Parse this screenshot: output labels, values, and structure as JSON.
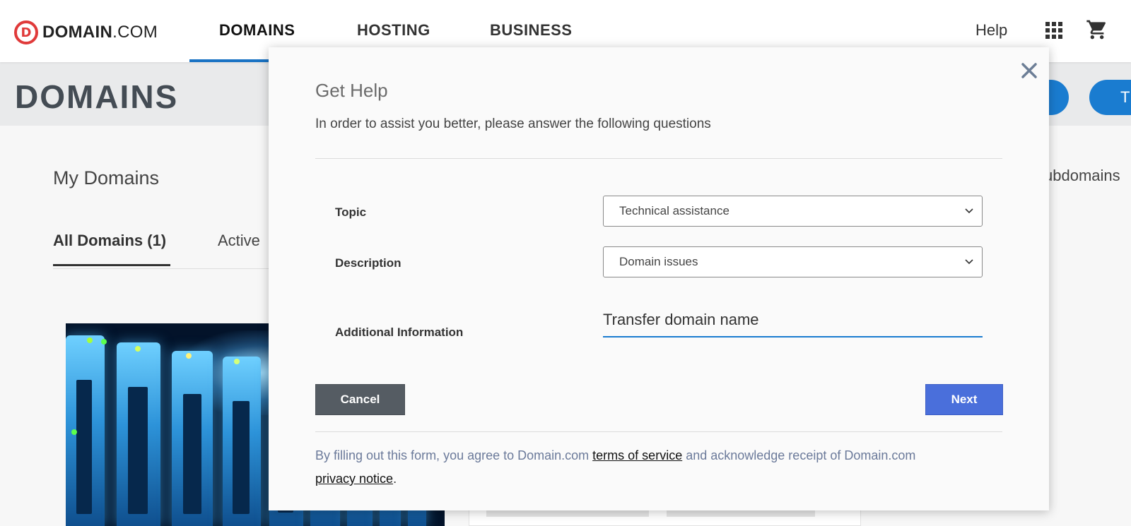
{
  "brand": {
    "logo_mark": "D",
    "name_bold": "DOMAIN",
    "name_light": ".COM"
  },
  "nav": {
    "items": [
      {
        "label": "DOMAINS",
        "active": true
      },
      {
        "label": "HOSTING",
        "active": false
      },
      {
        "label": "BUSINESS",
        "active": false
      }
    ],
    "help": "Help",
    "apps_icon": "apps-grid-icon",
    "cart_icon": "shopping-cart-icon"
  },
  "page": {
    "title": "DOMAINS",
    "button_partial": "T"
  },
  "background": {
    "section_title": "My Domains",
    "tabs": [
      "All Domains (1)",
      "Active"
    ],
    "subdomains_partial": "ubdomains"
  },
  "modal": {
    "title": "Get Help",
    "subtitle": "In order to assist you better, please answer the following questions",
    "fields": {
      "topic_label": "Topic",
      "topic_value": "Technical assistance",
      "description_label": "Description",
      "description_value": "Domain issues",
      "additional_label": "Additional Information",
      "additional_value": "Transfer domain name"
    },
    "cancel": "Cancel",
    "next": "Next",
    "footer": {
      "prefix": "By filling out this form, you agree to Domain.com ",
      "tos_link": "terms of service",
      "middle": " and acknowledge receipt of Domain.com",
      "privacy_link": "privacy notice",
      "suffix": "."
    }
  },
  "colors": {
    "accent": "#1a7cd0",
    "next_button": "#4a6fdb",
    "cancel_button": "#555c63",
    "brand_red": "#e03a3a"
  }
}
